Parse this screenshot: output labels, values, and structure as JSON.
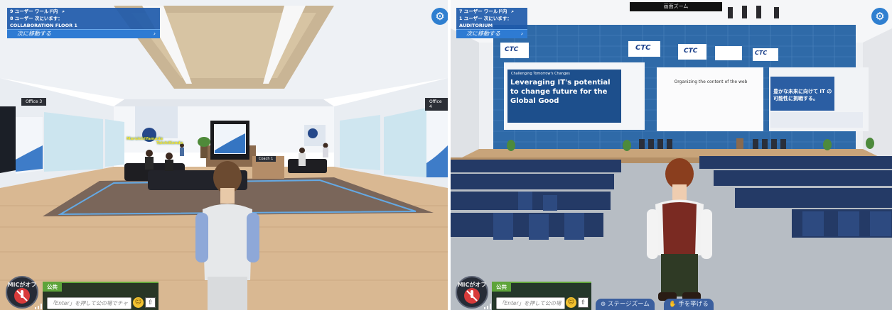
{
  "left": {
    "users_in_world": "9 ユーザー ワールド内",
    "users_here": "8 ユーザー 次にいます：",
    "location": "COLLABORATION FLOOR 1",
    "move_label": "次に移動する",
    "move_arrow": "›",
    "signs": [
      "Office 3",
      "Office 4",
      "Coach 1"
    ],
    "name_tags": [
      "MaruichiYamada",
      "TaichiKondo"
    ],
    "mic_label": "MICがオフ",
    "chat_tab": "公共",
    "chat_placeholder": "「Enter」を押して公の場でチャ"
  },
  "right": {
    "users_in_world": "7 ユーザー ワールド内",
    "users_here": "1 ユーザー 次にいます：",
    "location": "AUDITORIUM",
    "move_label": "次に移動する",
    "move_arrow": "›",
    "screen_zoom_label": "画面ズーム",
    "stage_logos": [
      "CTC",
      "CTC",
      "CTC",
      "CTC"
    ],
    "screen1_small": "Challenging Tomorrow's Changes",
    "screen1_title": "Leveraging IT's potential to change future for the Global Good",
    "screen2_title": "Organizing the content of the web",
    "screen3_title": "豊かな未来に向けて IT の可能性に挑戦する。",
    "mic_label": "MICがオフ",
    "chat_tab": "公共",
    "chat_placeholder": "「Enter」を押して公の場",
    "stage_zoom_label": "ステージズーム",
    "raise_hand_label": "手を挙げる"
  },
  "colors": {
    "hud_blue": "#1e5aaa",
    "accent_green": "#5da43a",
    "mic_red": "#d83a3a"
  },
  "icons": [
    "search-icon",
    "settings-gear-icon",
    "mic-off-icon",
    "signal-bars-icon",
    "emoji-icon",
    "upload-icon",
    "zoom-icon",
    "raise-hand-icon"
  ]
}
